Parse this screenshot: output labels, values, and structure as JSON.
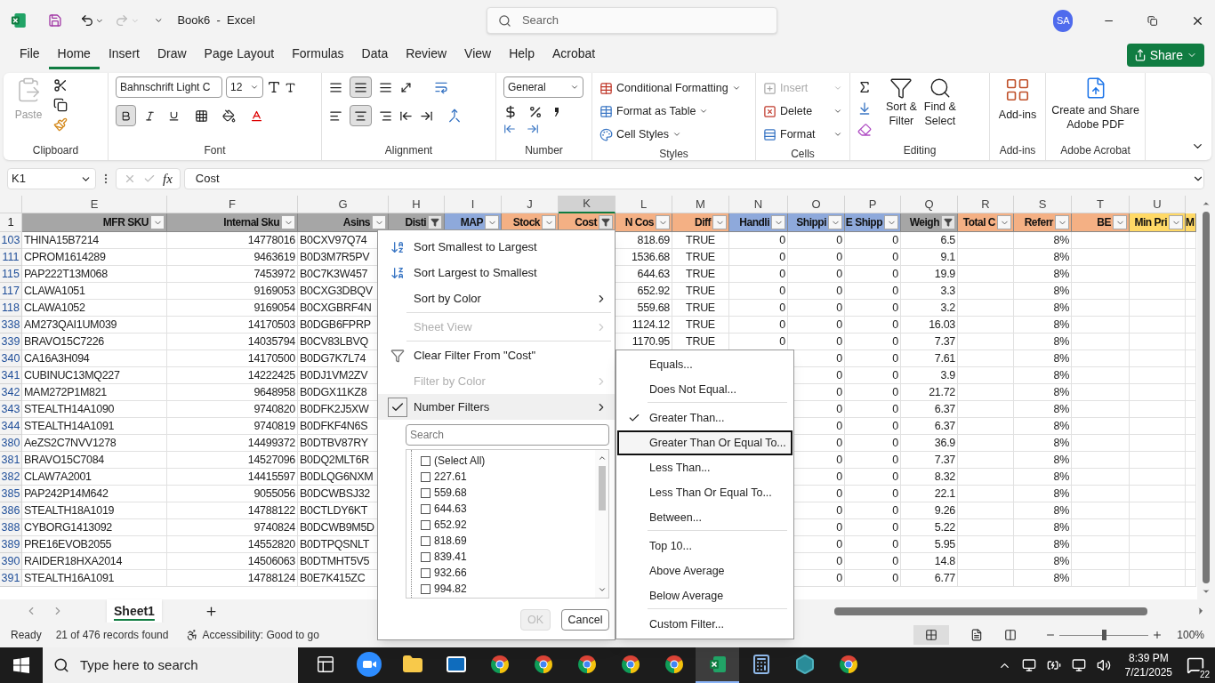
{
  "title_bar": {
    "title": "Book6  -  Excel",
    "search_placeholder": "Search",
    "avatar": "SA"
  },
  "ribbon_tabs": [
    {
      "label": "File",
      "selected": false
    },
    {
      "label": "Home",
      "selected": true
    },
    {
      "label": "Insert",
      "selected": false
    },
    {
      "label": "Draw",
      "selected": false
    },
    {
      "label": "Page Layout",
      "selected": false
    },
    {
      "label": "Formulas",
      "selected": false
    },
    {
      "label": "Data",
      "selected": false
    },
    {
      "label": "Review",
      "selected": false
    },
    {
      "label": "View",
      "selected": false
    },
    {
      "label": "Help",
      "selected": false
    },
    {
      "label": "Acrobat",
      "selected": false
    }
  ],
  "share_button": "Share",
  "ribbon": {
    "clipboard": {
      "label": "Clipboard",
      "paste": "Paste"
    },
    "font": {
      "label": "Font",
      "font_name": "Bahnschrift Light C",
      "font_size": "12",
      "bold_on": true
    },
    "alignment": {
      "label": "Alignment"
    },
    "number": {
      "label": "Number",
      "format": "General"
    },
    "styles": {
      "label": "Styles",
      "items": [
        "Conditional Formatting",
        "Format as Table",
        "Cell Styles"
      ]
    },
    "cells": {
      "label": "Cells",
      "items": [
        {
          "label": "Insert",
          "disabled": true
        },
        {
          "label": "Delete",
          "disabled": false
        },
        {
          "label": "Format",
          "disabled": false
        }
      ]
    },
    "editing": {
      "label": "Editing",
      "sort_filter": [
        "Sort &",
        "Filter"
      ],
      "find_select": [
        "Find &",
        "Select"
      ]
    },
    "addins": {
      "label": "Add-ins",
      "button": "Add-ins"
    },
    "acrobat": {
      "label": "Adobe Acrobat",
      "button": [
        "Create and Share",
        "Adobe PDF"
      ]
    }
  },
  "formula_bar": {
    "name_box": "K1",
    "fx": "fx",
    "value": "Cost"
  },
  "columns": [
    {
      "letter": "E",
      "selected": false
    },
    {
      "letter": "F",
      "selected": false
    },
    {
      "letter": "G",
      "selected": false
    },
    {
      "letter": "H",
      "selected": false
    },
    {
      "letter": "I",
      "selected": false
    },
    {
      "letter": "J",
      "selected": false
    },
    {
      "letter": "K",
      "selected": true
    },
    {
      "letter": "L",
      "selected": false
    },
    {
      "letter": "M",
      "selected": false
    },
    {
      "letter": "N",
      "selected": false
    },
    {
      "letter": "O",
      "selected": false
    },
    {
      "letter": "P",
      "selected": false
    },
    {
      "letter": "Q",
      "selected": false
    },
    {
      "letter": "R",
      "selected": false
    },
    {
      "letter": "S",
      "selected": false
    },
    {
      "letter": "T",
      "selected": false
    },
    {
      "letter": "U",
      "selected": false
    }
  ],
  "header_row": {
    "num": "1",
    "cells": [
      {
        "label": "MFR SKU",
        "color": "#a6a6a6",
        "filtered": false
      },
      {
        "label": "Internal Sku",
        "color": "#a6a6a6",
        "filtered": false
      },
      {
        "label": "Asins",
        "color": "#a6a6a6",
        "filtered": false
      },
      {
        "label": "Disti",
        "color": "#a6a6a6",
        "filtered": true
      },
      {
        "label": "MAP",
        "color": "#8ea9db",
        "filtered": false
      },
      {
        "label": "Stock",
        "color": "#f4b084",
        "filtered": false
      },
      {
        "label": "Cost",
        "color": "#f4b084",
        "filtered": true
      },
      {
        "label": "N Cos",
        "color": "#f4b084",
        "filtered": false
      },
      {
        "label": "Diff",
        "color": "#f4b084",
        "filtered": false
      },
      {
        "label": "Handli",
        "color": "#8ea9db",
        "filtered": false
      },
      {
        "label": "Shippi",
        "color": "#8ea9db",
        "filtered": false
      },
      {
        "label": "E Shipp",
        "color": "#8ea9db",
        "filtered": false
      },
      {
        "label": "Weigh",
        "color": "#a6a6a6",
        "filtered": true
      },
      {
        "label": "Total C",
        "color": "#f4b084",
        "filtered": false
      },
      {
        "label": "Referr",
        "color": "#f4b084",
        "filtered": false
      },
      {
        "label": "BE",
        "color": "#f4b084",
        "filtered": false
      },
      {
        "label": "Min Pri",
        "color": "#ffd966",
        "filtered": false
      },
      {
        "label": "M",
        "color": "#ffd966"
      }
    ]
  },
  "rows": [
    {
      "num": "103",
      "e": "THINA15B7214",
      "f": "14778016",
      "g": "B0CXV97Q74",
      "l": "818.69",
      "m": "TRUE",
      "n": "0",
      "o": "0",
      "p": "0",
      "q": "6.5",
      "s": "8%"
    },
    {
      "num": "111",
      "e": "CPROM1614289",
      "f": "9463619",
      "g": "B0D3M7R5PV",
      "l": "1536.68",
      "m": "TRUE",
      "n": "0",
      "o": "0",
      "p": "0",
      "q": "9.1",
      "s": "8%"
    },
    {
      "num": "115",
      "e": "PAP222T13M068",
      "f": "7453972",
      "g": "B0C7K3W457",
      "l": "644.63",
      "m": "TRUE",
      "n": "0",
      "o": "0",
      "p": "0",
      "q": "19.9",
      "s": "8%"
    },
    {
      "num": "117",
      "e": "CLAWA1051",
      "f": "9169053",
      "g": "B0CXG3DBQV",
      "l": "652.92",
      "m": "TRUE",
      "n": "0",
      "o": "0",
      "p": "0",
      "q": "3.3",
      "s": "8%"
    },
    {
      "num": "118",
      "e": "CLAWA1052",
      "f": "9169054",
      "g": "B0CXGBRF4N",
      "l": "559.68",
      "m": "TRUE",
      "n": "0",
      "o": "0",
      "p": "0",
      "q": "3.2",
      "s": "8%"
    },
    {
      "num": "338",
      "e": "AM273QAI1UM039",
      "f": "14170503",
      "g": "B0DGB6FPRP",
      "l": "1124.12",
      "m": "TRUE",
      "n": "0",
      "o": "0",
      "p": "0",
      "q": "16.03",
      "s": "8%"
    },
    {
      "num": "339",
      "e": "BRAVO15C7226",
      "f": "14035794",
      "g": "B0CV83LBVQ",
      "l": "1170.95",
      "m": "TRUE",
      "n": "0",
      "o": "0",
      "p": "0",
      "q": "7.37",
      "s": "8%"
    },
    {
      "num": "340",
      "e": "CA16A3H094",
      "f": "14170500",
      "g": "B0DG7K7L74",
      "o": "0",
      "p": "0",
      "q": "7.61",
      "s": "8%"
    },
    {
      "num": "341",
      "e": "CUBINUC13MQ227",
      "f": "14222425",
      "g": "B0DJ1VM2ZV",
      "o": "0",
      "p": "0",
      "q": "3.9",
      "s": "8%"
    },
    {
      "num": "342",
      "e": "MAM272P1M821",
      "f": "9648958",
      "g": "B0DGX11KZ8",
      "o": "0",
      "p": "0",
      "q": "21.72",
      "s": "8%"
    },
    {
      "num": "343",
      "e": "STEALTH14A1090",
      "f": "9740820",
      "g": "B0DFK2J5XW",
      "o": "0",
      "p": "0",
      "q": "6.37",
      "s": "8%"
    },
    {
      "num": "344",
      "e": "STEALTH14A1091",
      "f": "9740819",
      "g": "B0DFKF4N6S",
      "o": "0",
      "p": "0",
      "q": "6.37",
      "s": "8%"
    },
    {
      "num": "380",
      "e": "AeZS2C7NVV1278",
      "f": "14499372",
      "g": "B0DTBV87RY",
      "o": "0",
      "p": "0",
      "q": "36.9",
      "s": "8%"
    },
    {
      "num": "381",
      "e": "BRAVO15C7084",
      "f": "14527096",
      "g": "B0DQ2MLT6R",
      "o": "0",
      "p": "0",
      "q": "7.37",
      "s": "8%"
    },
    {
      "num": "382",
      "e": "CLAW7A2001",
      "f": "14415597",
      "g": "B0DLQG6NXM",
      "o": "0",
      "p": "0",
      "q": "8.32",
      "s": "8%"
    },
    {
      "num": "385",
      "e": "PAP242P14M642",
      "f": "9055056",
      "g": "B0DCWBSJ32",
      "o": "0",
      "p": "0",
      "q": "22.1",
      "s": "8%"
    },
    {
      "num": "386",
      "e": "STEALTH18A1019",
      "f": "14788122",
      "g": "B0CTLDY6KT",
      "o": "0",
      "p": "0",
      "q": "9.26",
      "s": "8%"
    },
    {
      "num": "388",
      "e": "CYBORG1413092",
      "f": "9740824",
      "g": "B0DCWB9M5D",
      "o": "0",
      "p": "0",
      "q": "5.22",
      "s": "8%"
    },
    {
      "num": "389",
      "e": "PRE16EVOB2055",
      "f": "14552820",
      "g": "B0DTPQSNLT",
      "o": "0",
      "p": "0",
      "q": "5.95",
      "s": "8%"
    },
    {
      "num": "390",
      "e": "RAIDER18HXA2014",
      "f": "14506063",
      "g": "B0DTMHT5V5",
      "o": "0",
      "p": "0",
      "q": "14.8",
      "s": "8%"
    },
    {
      "num": "391",
      "e": "STEALTH16A1091",
      "f": "14788124",
      "g": "B0E7K415ZC",
      "o": "0",
      "p": "0",
      "q": "6.77",
      "s": "8%"
    }
  ],
  "filter_menu": {
    "items": [
      {
        "kind": "sort_asc",
        "label": "Sort Smallest to Largest",
        "disabled": false,
        "checked": false,
        "separator_after": false
      },
      {
        "kind": "sort_desc",
        "label": "Sort Largest to Smallest",
        "disabled": false,
        "checked": false,
        "separator_after": false
      },
      {
        "kind": "submenu",
        "label": "Sort by Color",
        "disabled": false,
        "checked": false,
        "separator_after": true
      },
      {
        "kind": "submenu",
        "label": "Sheet View",
        "disabled": true,
        "checked": false,
        "separator_after": true
      },
      {
        "kind": "clear",
        "label": "Clear Filter From \"Cost\"",
        "disabled": false,
        "checked": false,
        "separator_after": false
      },
      {
        "kind": "submenu",
        "label": "Filter by Color",
        "disabled": true,
        "checked": false,
        "separator_after": false
      },
      {
        "kind": "submenu",
        "label": "Number Filters",
        "disabled": false,
        "checked": true,
        "separator_after": false
      }
    ],
    "search_placeholder": "Search",
    "values": [
      {
        "label": "(Select All)",
        "checked": false
      },
      {
        "label": "227.61",
        "checked": false
      },
      {
        "label": "559.68",
        "checked": false
      },
      {
        "label": "644.63",
        "checked": false
      },
      {
        "label": "652.92",
        "checked": false
      },
      {
        "label": "818.69",
        "checked": false
      },
      {
        "label": "839.41",
        "checked": false
      },
      {
        "label": "932.66",
        "checked": false
      },
      {
        "label": "994.82",
        "checked": false
      }
    ],
    "ok": {
      "label": "OK",
      "disabled": true
    },
    "cancel": "Cancel"
  },
  "number_filters_menu": [
    {
      "label": "Equals...",
      "checked": false,
      "selected": false,
      "separator_after": false
    },
    {
      "label": "Does Not Equal...",
      "checked": false,
      "selected": false,
      "separator_after": true
    },
    {
      "label": "Greater Than...",
      "checked": true,
      "selected": false,
      "separator_after": false
    },
    {
      "label": "Greater Than Or Equal To...",
      "checked": false,
      "selected": true,
      "separator_after": false
    },
    {
      "label": "Less Than...",
      "checked": false,
      "selected": false,
      "separator_after": false
    },
    {
      "label": "Less Than Or Equal To...",
      "checked": false,
      "selected": false,
      "separator_after": false
    },
    {
      "label": "Between...",
      "checked": false,
      "selected": false,
      "separator_after": true
    },
    {
      "label": "Top 10...",
      "checked": false,
      "selected": false,
      "separator_after": false
    },
    {
      "label": "Above Average",
      "checked": false,
      "selected": false,
      "separator_after": false
    },
    {
      "label": "Below Average",
      "checked": false,
      "selected": false,
      "separator_after": true
    },
    {
      "label": "Custom Filter...",
      "checked": false,
      "selected": false,
      "separator_after": false
    }
  ],
  "sheet_tabs": [
    {
      "label": "Sheet1",
      "selected": true
    }
  ],
  "status_bar": {
    "mode": "Ready",
    "records": "21 of 476 records found",
    "accessibility": "Accessibility: Good to go",
    "zoom": {
      "level": 0.5
    },
    "zoom_label": "100%"
  },
  "taskbar": {
    "search_placeholder": "Type here to search",
    "apps": [
      {
        "kind": "taskview",
        "selected": false
      },
      {
        "kind": "zoom",
        "selected": false
      },
      {
        "kind": "folder",
        "selected": false
      },
      {
        "kind": "mail",
        "selected": false
      },
      {
        "kind": "chrome",
        "selected": false
      },
      {
        "kind": "chrome",
        "selected": false
      },
      {
        "kind": "chrome",
        "selected": false
      },
      {
        "kind": "chrome",
        "selected": false
      },
      {
        "kind": "chrome",
        "selected": false
      },
      {
        "kind": "excel",
        "selected": true
      },
      {
        "kind": "calculator",
        "selected": false
      },
      {
        "kind": "hexagon",
        "selected": false
      },
      {
        "kind": "chrome",
        "selected": false
      }
    ],
    "time": "8:39 PM",
    "date": "7/21/2025",
    "notifications": "22"
  }
}
